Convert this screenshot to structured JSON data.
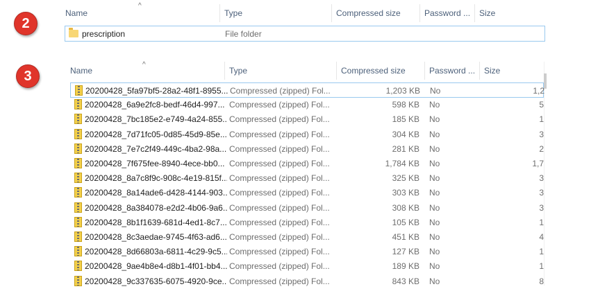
{
  "badges": [
    "2",
    "3"
  ],
  "top_list": {
    "columns": [
      "Name",
      "Type",
      "Compressed size",
      "Password ...",
      "Size"
    ],
    "rows": [
      {
        "name": "prescription",
        "type": "File folder",
        "icon": "folder-icon"
      }
    ]
  },
  "bottom_list": {
    "columns": [
      "Name",
      "Type",
      "Compressed size",
      "Password ...",
      "Size"
    ],
    "rows": [
      {
        "name": "20200428_5fa97bf5-28a2-48f1-8955...",
        "type": "Compressed (zipped) Fol...",
        "compressed": "1,203 KB",
        "password": "No",
        "size": "1,2"
      },
      {
        "name": "20200428_6a9e2fc8-bedf-46d4-997...",
        "type": "Compressed (zipped) Fol...",
        "compressed": "598 KB",
        "password": "No",
        "size": "5"
      },
      {
        "name": "20200428_7bc185e2-e749-4a24-855...",
        "type": "Compressed (zipped) Fol...",
        "compressed": "185 KB",
        "password": "No",
        "size": "1"
      },
      {
        "name": "20200428_7d71fc05-0d85-45d9-85e...",
        "type": "Compressed (zipped) Fol...",
        "compressed": "304 KB",
        "password": "No",
        "size": "3"
      },
      {
        "name": "20200428_7e7c2f49-449c-4ba2-98a...",
        "type": "Compressed (zipped) Fol...",
        "compressed": "281 KB",
        "password": "No",
        "size": "2"
      },
      {
        "name": "20200428_7f675fee-8940-4ece-bb0...",
        "type": "Compressed (zipped) Fol...",
        "compressed": "1,784 KB",
        "password": "No",
        "size": "1,7"
      },
      {
        "name": "20200428_8a7c8f9c-908c-4e19-815f...",
        "type": "Compressed (zipped) Fol...",
        "compressed": "325 KB",
        "password": "No",
        "size": "3"
      },
      {
        "name": "20200428_8a14ade6-d428-4144-903...",
        "type": "Compressed (zipped) Fol...",
        "compressed": "303 KB",
        "password": "No",
        "size": "3"
      },
      {
        "name": "20200428_8a384078-e2d2-4b06-9a6...",
        "type": "Compressed (zipped) Fol...",
        "compressed": "308 KB",
        "password": "No",
        "size": "3"
      },
      {
        "name": "20200428_8b1f1639-681d-4ed1-8c7...",
        "type": "Compressed (zipped) Fol...",
        "compressed": "105 KB",
        "password": "No",
        "size": "1"
      },
      {
        "name": "20200428_8c3aedae-9745-4f63-ad6...",
        "type": "Compressed (zipped) Fol...",
        "compressed": "451 KB",
        "password": "No",
        "size": "4"
      },
      {
        "name": "20200428_8d66803a-6811-4c29-9c5...",
        "type": "Compressed (zipped) Fol...",
        "compressed": "127 KB",
        "password": "No",
        "size": "1"
      },
      {
        "name": "20200428_9ae4b8e4-d8b1-4f01-bb4...",
        "type": "Compressed (zipped) Fol...",
        "compressed": "189 KB",
        "password": "No",
        "size": "1"
      },
      {
        "name": "20200428_9c337635-6075-4920-9ce...",
        "type": "Compressed (zipped) Fol...",
        "compressed": "843 KB",
        "password": "No",
        "size": "8"
      }
    ]
  }
}
